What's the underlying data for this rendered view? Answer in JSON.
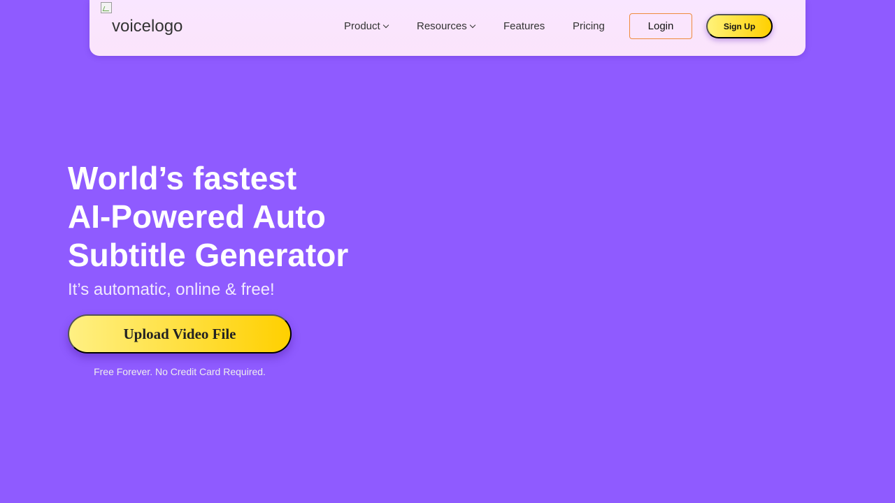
{
  "header": {
    "logo_alt": "voicelogo",
    "nav": {
      "product": "Product",
      "resources": "Resources",
      "features": "Features",
      "pricing": "Pricing"
    },
    "login_label": "Login",
    "signup_label": "Sign Up"
  },
  "hero": {
    "title_lines": [
      "World’s fastest",
      "AI-Powered Auto",
      "Subtitle Generator"
    ],
    "subtitle": "It’s automatic, online & free!",
    "upload_label": "Upload Video File",
    "note": "Free Forever. No Credit Card Required."
  },
  "colors": {
    "background": "#8f5bff",
    "accent_yellow": "#ffd000",
    "login_border": "#ef8a3c"
  }
}
